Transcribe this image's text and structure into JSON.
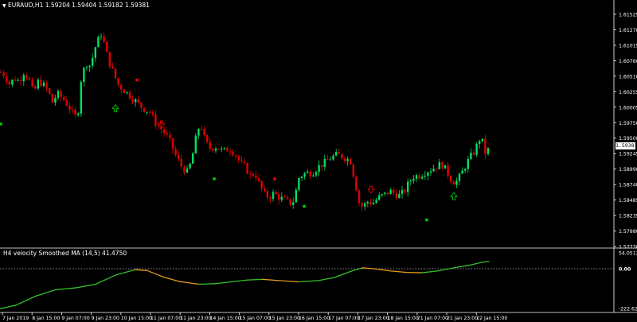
{
  "header": {
    "symbol_line": "EURAUD,H1  1.59204 1.59404 1.59182 1.59381",
    "indicator_line": "H4 velocity Smoothed MA (14,5) 41.4750"
  },
  "price_box": "1.59381",
  "colors": {
    "background": "#000000",
    "bull": "#00e060",
    "bear": "#e00000",
    "axis": "#ffffff",
    "oscillator_rising": "#34c02c",
    "oscillator_falling": "#e69a1e",
    "signal_up": "#00c000",
    "signal_down": "#e00000"
  },
  "chart_data": [
    {
      "type": "candlestick",
      "title": "EURAUD,H1",
      "y_ticks": [
        "1.61525",
        "1.61270",
        "1.61015",
        "1.60760",
        "1.60510",
        "1.60255",
        "1.60005",
        "1.59750",
        "1.59500",
        "1.59245",
        "1.58990",
        "1.58740",
        "1.58485",
        "1.58235",
        "1.57980",
        "1.57730"
      ],
      "ylim": [
        1.5773,
        1.6165
      ],
      "x_ticks": [
        "7 Jan 2019",
        "8 Jan 15:00",
        "9 Jan 07:00",
        "9 Jan 23:00",
        "10 Jan 15:00",
        "11 Jan 07:00",
        "11 Jan 23:00",
        "14 Jan 15:00",
        "15 Jan 07:00",
        "15 Jan 23:00",
        "16 Jan 15:00",
        "17 Jan 07:00",
        "17 Jan 23:00",
        "18 Jan 15:00",
        "21 Jan 07:00",
        "21 Jan 23:00",
        "22 Jan 15:00"
      ],
      "close_path": [
        [
          0,
          1.606
        ],
        [
          6,
          1.6055
        ],
        [
          12,
          1.604
        ],
        [
          18,
          1.605
        ],
        [
          24,
          1.6045
        ],
        [
          30,
          1.606
        ],
        [
          36,
          1.605
        ],
        [
          42,
          1.6025
        ],
        [
          48,
          1.6045
        ],
        [
          54,
          1.604
        ],
        [
          60,
          1.603
        ],
        [
          66,
          1.601
        ],
        [
          72,
          1.6025
        ],
        [
          80,
          1.6015
        ],
        [
          88,
          1.6
        ],
        [
          94,
          1.5985
        ],
        [
          98,
          1.5995
        ],
        [
          102,
          1.605
        ],
        [
          108,
          1.6075
        ],
        [
          114,
          1.607
        ],
        [
          118,
          1.6095
        ],
        [
          124,
          1.6115
        ],
        [
          128,
          1.6125
        ],
        [
          131,
          1.6105
        ],
        [
          136,
          1.608
        ],
        [
          142,
          1.606
        ],
        [
          148,
          1.604
        ],
        [
          156,
          1.603
        ],
        [
          164,
          1.602
        ],
        [
          172,
          1.601
        ],
        [
          180,
          1.6
        ],
        [
          188,
          1.5995
        ],
        [
          196,
          1.5975
        ],
        [
          204,
          1.5965
        ],
        [
          212,
          1.595
        ],
        [
          220,
          1.5925
        ],
        [
          228,
          1.5905
        ],
        [
          236,
          1.5895
        ],
        [
          242,
          1.5925
        ],
        [
          248,
          1.5965
        ],
        [
          252,
          1.5975
        ],
        [
          258,
          1.5945
        ],
        [
          264,
          1.5935
        ],
        [
          272,
          1.5938
        ],
        [
          280,
          1.593
        ],
        [
          288,
          1.5935
        ],
        [
          296,
          1.5925
        ],
        [
          302,
          1.591
        ],
        [
          308,
          1.5905
        ],
        [
          314,
          1.589
        ],
        [
          320,
          1.5895
        ],
        [
          326,
          1.5875
        ],
        [
          332,
          1.586
        ],
        [
          338,
          1.5855
        ],
        [
          344,
          1.5862
        ],
        [
          350,
          1.5855
        ],
        [
          358,
          1.585
        ],
        [
          364,
          1.5845
        ],
        [
          370,
          1.585
        ],
        [
          374,
          1.5885
        ],
        [
          378,
          1.589
        ],
        [
          384,
          1.5895
        ],
        [
          392,
          1.5895
        ],
        [
          400,
          1.5905
        ],
        [
          408,
          1.5912
        ],
        [
          416,
          1.592
        ],
        [
          424,
          1.5925
        ],
        [
          432,
          1.592
        ],
        [
          440,
          1.5915
        ],
        [
          446,
          1.588
        ],
        [
          452,
          1.584
        ],
        [
          456,
          1.584
        ],
        [
          462,
          1.5848
        ],
        [
          468,
          1.5845
        ],
        [
          476,
          1.5855
        ],
        [
          484,
          1.586
        ],
        [
          490,
          1.5865
        ],
        [
          496,
          1.586
        ],
        [
          502,
          1.5858
        ],
        [
          508,
          1.5865
        ],
        [
          514,
          1.588
        ],
        [
          520,
          1.589
        ],
        [
          526,
          1.589
        ],
        [
          532,
          1.5895
        ],
        [
          540,
          1.59
        ],
        [
          548,
          1.5905
        ],
        [
          554,
          1.591
        ],
        [
          560,
          1.59
        ],
        [
          566,
          1.5885
        ],
        [
          572,
          1.5878
        ],
        [
          578,
          1.589
        ],
        [
          584,
          1.5905
        ],
        [
          590,
          1.592
        ],
        [
          596,
          1.593
        ],
        [
          602,
          1.595
        ],
        [
          606,
          1.5945
        ],
        [
          610,
          1.5925
        ],
        [
          614,
          1.5935
        ]
      ],
      "arrows_up": [
        [
          145,
          1.6
        ],
        [
          570,
          1.5856
        ]
      ],
      "arrows_down": [
        [
          203,
          1.5975
        ],
        [
          466,
          1.5868
        ]
      ],
      "dots_up": [
        [
          0,
          1.5975
        ],
        [
          268,
          1.5885
        ],
        [
          381,
          1.584
        ],
        [
          535,
          1.5818
        ]
      ],
      "dots_down": [
        [
          172,
          1.6047
        ],
        [
          345,
          1.5885
        ]
      ]
    },
    {
      "type": "line",
      "title": "H4 velocity Smoothed MA (14,5)",
      "current_value": "41.4750",
      "y_ticks": [
        "54.0512",
        "0.00",
        "-222.6268"
      ],
      "ylim": [
        -222.6268,
        70
      ],
      "zero_line": 0,
      "series_points": [
        [
          0,
          -220
        ],
        [
          20,
          -200
        ],
        [
          45,
          -150
        ],
        [
          70,
          -115
        ],
        [
          95,
          -105
        ],
        [
          120,
          -85
        ],
        [
          145,
          -35
        ],
        [
          170,
          -5
        ],
        [
          185,
          -10
        ],
        [
          205,
          -45
        ],
        [
          225,
          -70
        ],
        [
          250,
          -85
        ],
        [
          270,
          -82
        ],
        [
          290,
          -72
        ],
        [
          310,
          -62
        ],
        [
          330,
          -58
        ],
        [
          350,
          -65
        ],
        [
          375,
          -72
        ],
        [
          400,
          -65
        ],
        [
          420,
          -48
        ],
        [
          440,
          -15
        ],
        [
          455,
          5
        ],
        [
          470,
          0
        ],
        [
          490,
          -12
        ],
        [
          510,
          -20
        ],
        [
          530,
          -22
        ],
        [
          550,
          -12
        ],
        [
          570,
          5
        ],
        [
          590,
          20
        ],
        [
          605,
          35
        ],
        [
          614,
          41
        ]
      ]
    }
  ]
}
